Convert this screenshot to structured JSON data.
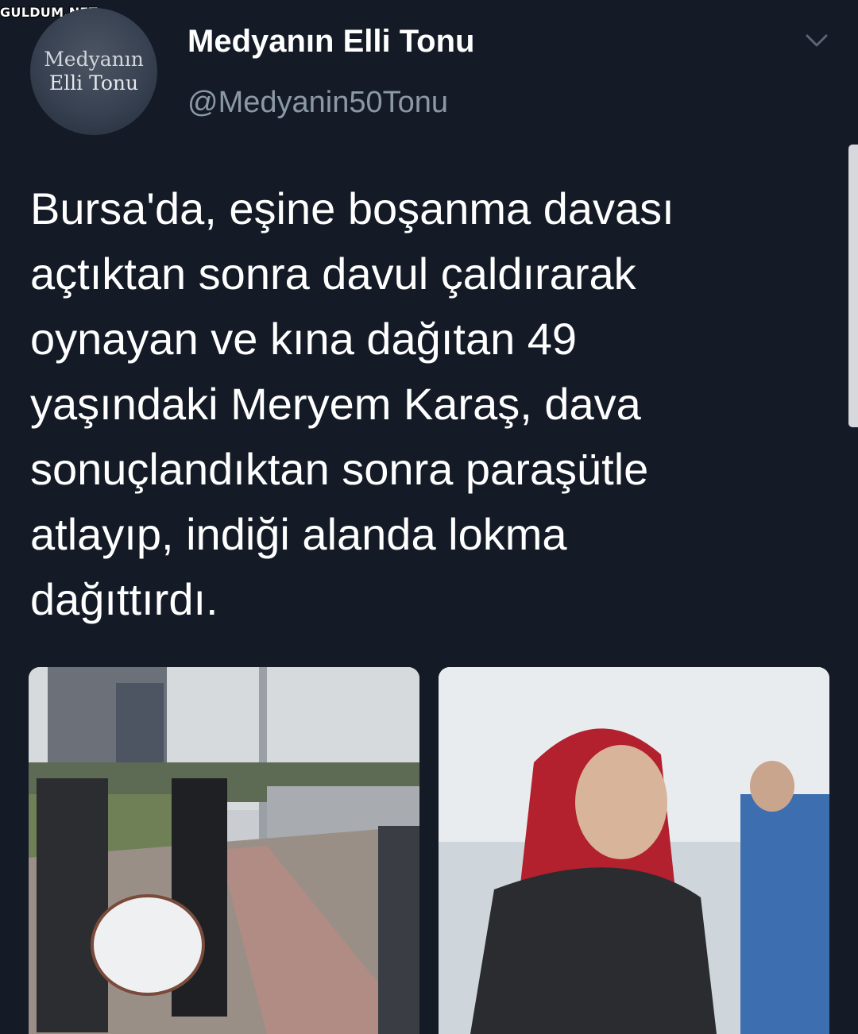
{
  "watermark": "GULDUM.NET",
  "tweet": {
    "avatar_line1": "Medyanın",
    "avatar_line2": "Elli Tonu",
    "display_name": "Medyanın Elli Tonu",
    "handle": "@Medyanin50Tonu",
    "text": "Bursa'da, eşine boşanma davası\naçtıktan sonra davul çaldırarak\noynayan ve kına dağıtan 49\nyaşındaki Meryem Karaş, dava\nsonuçlandıktan sonra paraşütle\natlayıp, indiği alanda lokma\ndağıttırdı.",
    "menu_icon": "chevron-down-icon"
  },
  "colors": {
    "background": "#141b26",
    "secondary_text": "#8b98a5",
    "text": "#ffffff"
  }
}
